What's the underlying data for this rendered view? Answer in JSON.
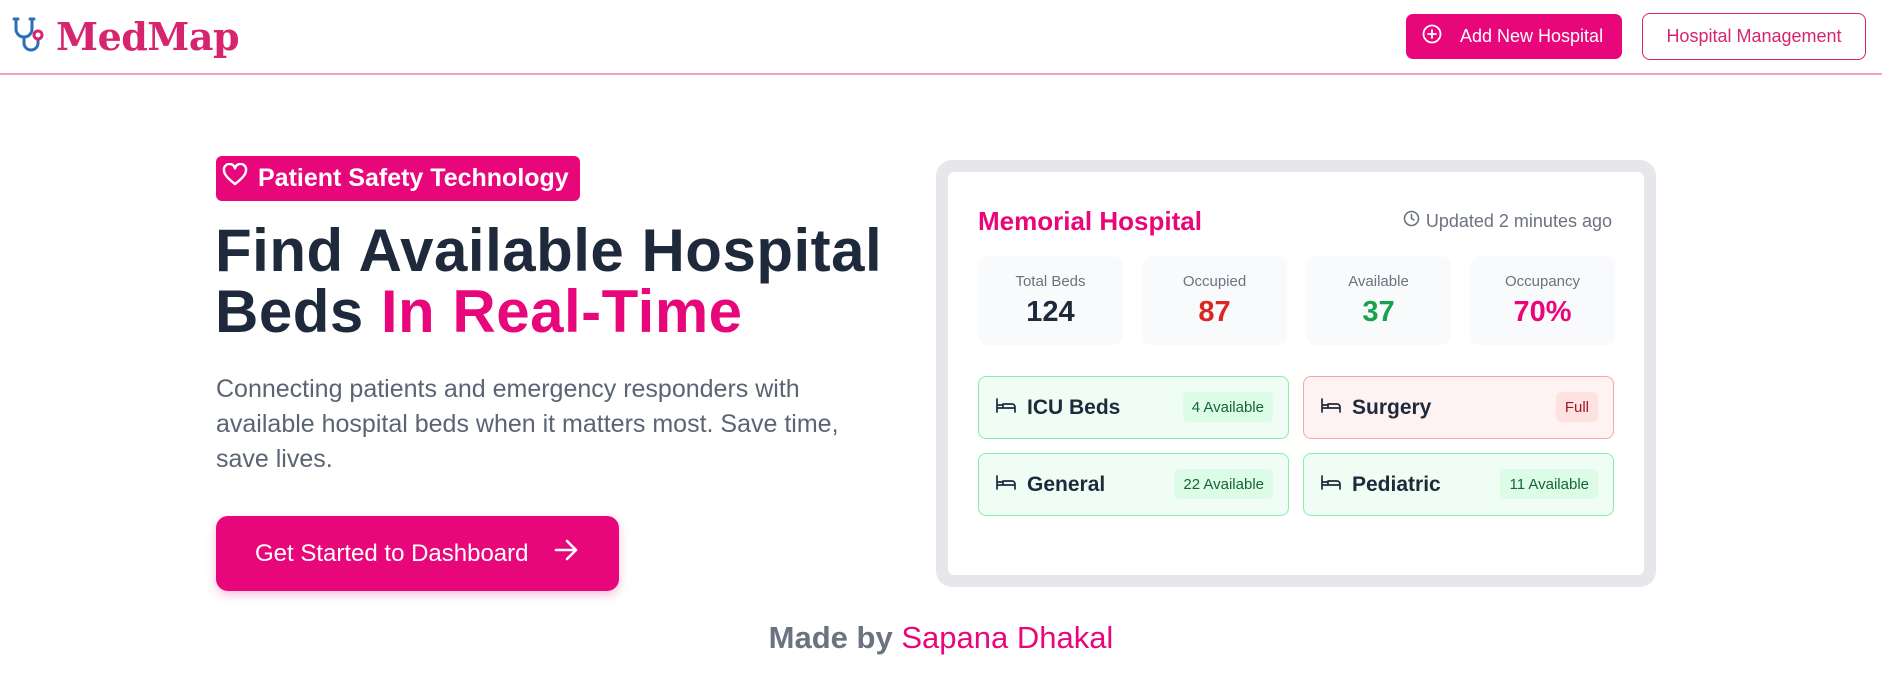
{
  "header": {
    "logo_text": "MedMap",
    "logo_icon": "stethoscope-icon",
    "add_button_label": "Add New Hospital",
    "add_button_icon": "plus-circle-icon",
    "manage_button_label": "Hospital Management"
  },
  "hero": {
    "badge_label": "Patient Safety Technology",
    "badge_icon": "heart-icon",
    "headline_line1": "Find Available Hospital",
    "headline_line2_plain": "Beds ",
    "headline_line2_accent": "In Real-Time",
    "description": "Connecting patients and emergency responders with available hospital beds when it matters most. Save time, save lives.",
    "cta_label": "Get Started to Dashboard",
    "cta_icon": "arrow-right-icon"
  },
  "card": {
    "hospital_name": "Memorial Hospital",
    "updated_text": "Updated 2 minutes ago",
    "updated_icon": "clock-icon",
    "stats": [
      {
        "label": "Total Beds",
        "value": "124",
        "color": "#1e2a3c"
      },
      {
        "label": "Occupied",
        "value": "87",
        "color": "#dc2626"
      },
      {
        "label": "Available",
        "value": "37",
        "color": "#16a34a"
      },
      {
        "label": "Occupancy",
        "value": "70%",
        "color": "#e8077a"
      }
    ],
    "wards": [
      {
        "name": "ICU Beds",
        "status": "4 Available",
        "state": "ok"
      },
      {
        "name": "Surgery",
        "status": "Full",
        "state": "full"
      },
      {
        "name": "General",
        "status": "22 Available",
        "state": "ok"
      },
      {
        "name": "Pediatric",
        "status": "11 Available",
        "state": "ok"
      }
    ],
    "ward_icon": "bed-icon"
  },
  "footer": {
    "made_by": "Made by",
    "author": "Sapana Dhakal"
  },
  "colors": {
    "brand": "#e8077a",
    "heading": "#1e2a3c",
    "muted": "#6b7280",
    "success": "#16a34a",
    "danger": "#dc2626"
  }
}
